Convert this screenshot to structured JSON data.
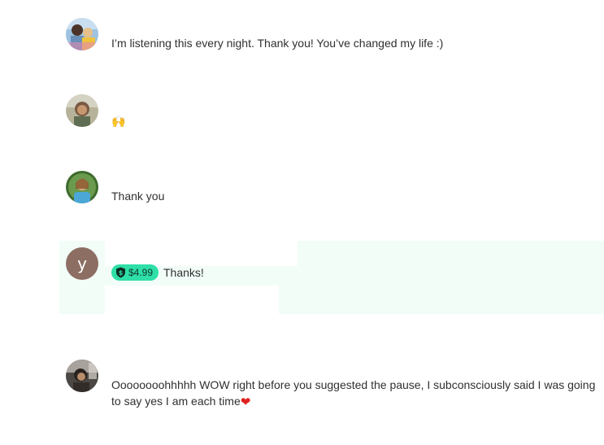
{
  "comments": [
    {
      "text": "I’m listening this every night. Thank you! You’ve changed my life :)"
    },
    {
      "text": "🙌",
      "emoji_name": "raising-hands"
    },
    {
      "text": "Thank you"
    },
    {
      "avatar_letter": "y",
      "tip": "$4.99",
      "text": "Thanks!",
      "highlight_color": "#f2fdf8",
      "badge_color": "#2edfa7",
      "avatar_color": "#8d6e63"
    },
    {
      "text_line1": "Oooooooohhhhh WOW right before you suggested the pause, I subconsciously said I was going",
      "text_line2": "to say yes I am each time",
      "trailing_icon": "red-heart-icon",
      "heart": "❤"
    }
  ]
}
